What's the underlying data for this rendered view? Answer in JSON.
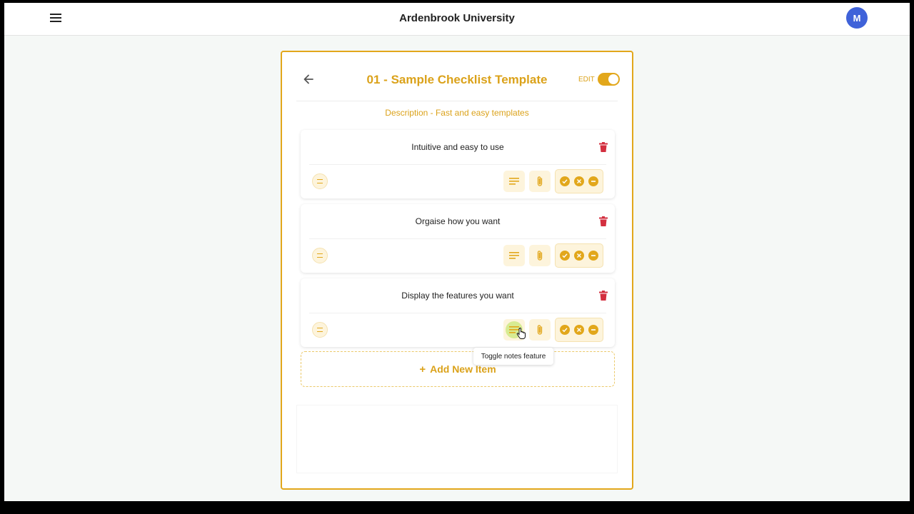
{
  "app": {
    "title": "Ardenbrook University",
    "avatar_initial": "M"
  },
  "template": {
    "title": "01 - Sample Checklist Template",
    "edit_label": "EDIT",
    "edit_enabled": true,
    "description": "Description - Fast and easy templates"
  },
  "items": [
    {
      "title": "Intuitive and easy to use"
    },
    {
      "title": "Orgaise how you want"
    },
    {
      "title": "Display the features you want"
    }
  ],
  "add_item_label": "Add New Item",
  "add_item_symbol": "+",
  "tooltip": "Toggle notes feature",
  "colors": {
    "accent": "#e2a71b",
    "accent_light": "#fdf4dc",
    "danger": "#d32f3f",
    "avatar": "#3f62d9"
  },
  "icons": {
    "menu": "hamburger-icon",
    "back": "arrow-left-icon",
    "trash": "trash-icon",
    "drag": "drag-handle-icon",
    "notes": "notes-icon",
    "attach": "paperclip-icon",
    "pass": "check-circle-icon",
    "fail": "x-circle-icon",
    "na": "minus-circle-icon"
  }
}
